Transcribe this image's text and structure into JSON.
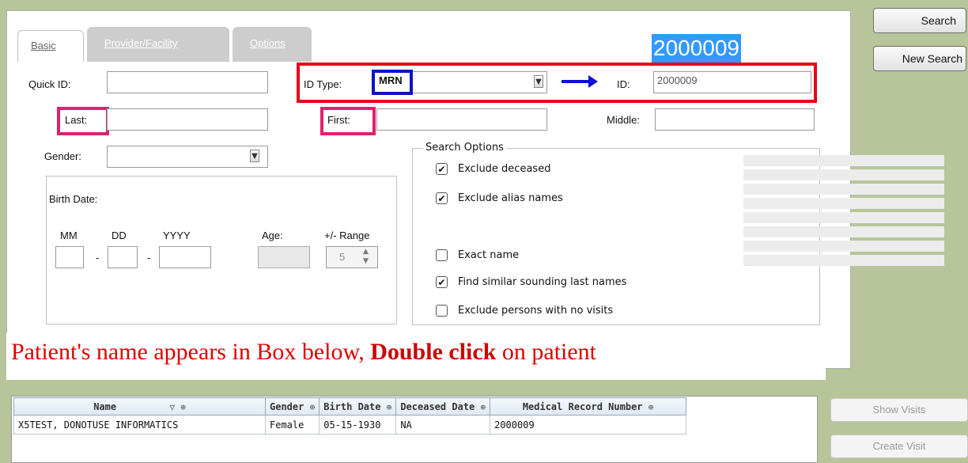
{
  "tabs": {
    "basic": "Basic",
    "provider": "Provider/Facility",
    "options": "Options"
  },
  "highlight_value": "2000009",
  "buttons": {
    "search": "Search",
    "new_search": "New Search",
    "show_visits": "Show Visits",
    "create_visit": "Create Visit"
  },
  "fields": {
    "quick_id_label": "Quick ID:",
    "id_type_label": "ID Type:",
    "id_type_value": "MRN",
    "id_label": "ID:",
    "id_value": "2000009",
    "last_label": "Last:",
    "first_label": "First:",
    "middle_label": "Middle:",
    "gender_label": "Gender:",
    "birth_date_label": "Birth Date:",
    "mm_label": "MM",
    "dd_label": "DD",
    "yyyy_label": "YYYY",
    "age_label": "Age:",
    "range_label": "+/- Range",
    "range_value": "5",
    "date_sep": "-"
  },
  "search_options": {
    "title": "Search Options",
    "items": [
      {
        "label": "Exclude deceased",
        "checked": true
      },
      {
        "label": "Exclude alias names",
        "checked": true
      },
      {
        "label": "Exact name",
        "checked": false
      },
      {
        "label": "Find similar sounding last names",
        "checked": true
      },
      {
        "label": "Exclude persons with no visits",
        "checked": false
      }
    ]
  },
  "annotation": {
    "prefix": "Patient's name appears in Box below, ",
    "bold": "Double click",
    "suffix": " on patient"
  },
  "results": {
    "columns": [
      "Name",
      "Gender",
      "Birth Date",
      "Deceased Date",
      "Medical Record Number"
    ],
    "rows": [
      [
        "X5TEST, DONOTUSE INFORMATICS",
        "Female",
        "05-15-1930",
        "NA",
        "2000009"
      ]
    ]
  },
  "colors": {
    "highlight_red": "#e8001c",
    "highlight_blue": "#1010c8",
    "highlight_pink": "#e0206f",
    "selection_blue": "#3399ff",
    "annotation_red": "#e00000",
    "background": "#b8c49a"
  }
}
